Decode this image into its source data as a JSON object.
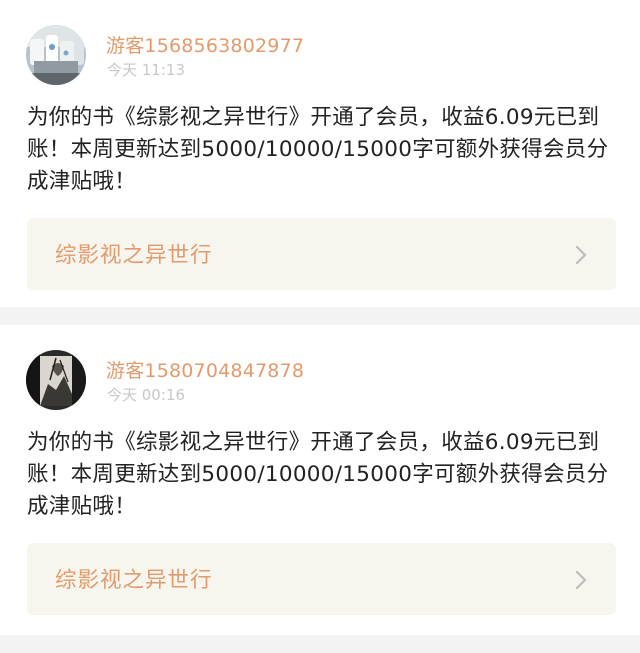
{
  "notifications": [
    {
      "username": "游客1568563802977",
      "time": "今天 11:13",
      "message": "为你的书《综影视之异世行》开通了会员，收益6.09元已到账！本周更新达到5000/10000/15000字可额外获得会员分成津贴哦！",
      "book_title": "综影视之异世行",
      "avatar_icon": "avatar-photo-icon"
    },
    {
      "username": "游客1580704847878",
      "time": "今天 00:16",
      "message": "为你的书《综影视之异世行》开通了会员，收益6.09元已到账！本周更新达到5000/10000/15000字可额外获得会员分成津贴哦！",
      "book_title": "综影视之异世行",
      "avatar_icon": "avatar-photo-icon"
    }
  ],
  "colors": {
    "accent": "#e39a6c",
    "timestamp": "#c8c8c8",
    "text": "#222222",
    "link_bg": "#f6f5ee",
    "page_bg": "#f3f3f3"
  }
}
